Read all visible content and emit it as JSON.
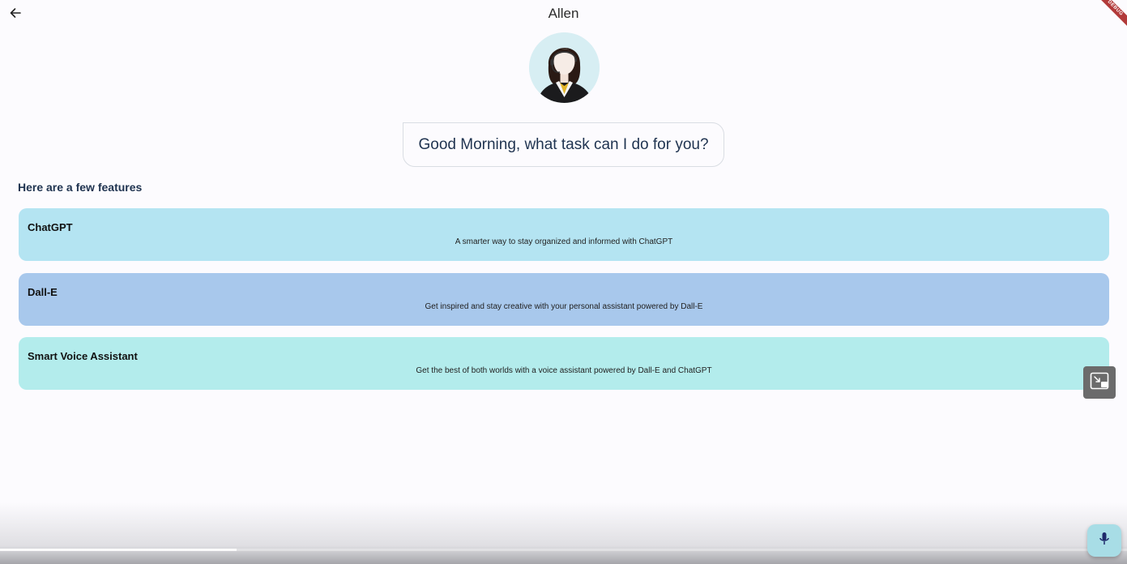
{
  "app_bar": {
    "title": "Allen",
    "back_icon": "arrow-back-icon",
    "debug_label": "DEBUG"
  },
  "assistant": {
    "avatar_icon": "assistant-avatar-icon",
    "greeting": "Good Morning, what task can I do for you?"
  },
  "features": {
    "heading": "Here are a few features",
    "items": [
      {
        "title": "ChatGPT",
        "description": "A smarter way to stay organized and informed with ChatGPT",
        "color": "#b4e4f2"
      },
      {
        "title": "Dall-E",
        "description": "Get inspired and stay creative with your personal assistant powered by Dall-E",
        "color": "#a8c8ec"
      },
      {
        "title": "Smart Voice Assistant",
        "description": "Get the best of both worlds with a voice assistant powered by Dall-E and ChatGPT",
        "color": "#b3ecec"
      }
    ]
  },
  "overlay": {
    "pip_icon": "picture-in-picture-icon",
    "video_progress": 0.21
  },
  "fab": {
    "icon": "microphone-icon",
    "color": "#a8dde6"
  }
}
